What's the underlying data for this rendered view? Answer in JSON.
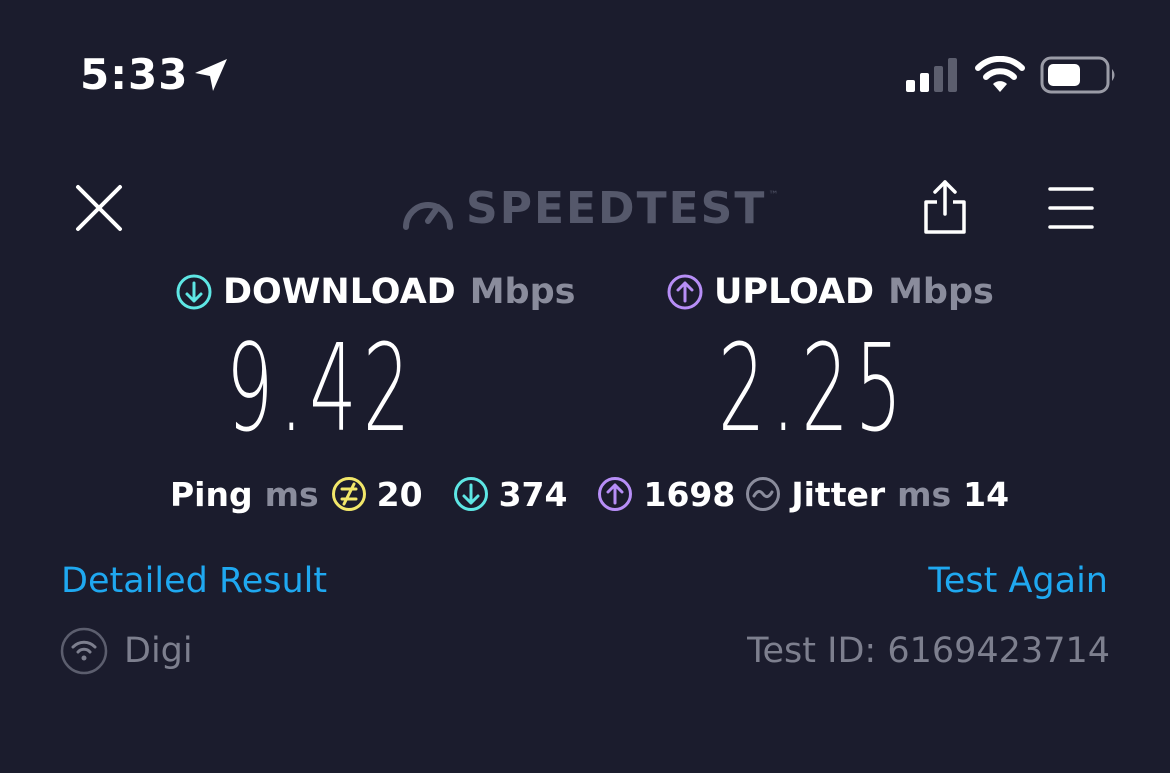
{
  "status_bar": {
    "time": "5:33",
    "icons": [
      "location-arrow-icon",
      "cellular-signal-icon",
      "wifi-icon",
      "battery-icon"
    ]
  },
  "header": {
    "logo_text": "SPEEDTEST",
    "logo_mark": "™",
    "icons": [
      "close-icon",
      "speedometer-icon",
      "share-icon",
      "menu-icon"
    ]
  },
  "download": {
    "label": "DOWNLOAD",
    "unit": "Mbps",
    "value": "9.42",
    "color": "#5ee6e4"
  },
  "upload": {
    "label": "UPLOAD",
    "unit": "Mbps",
    "value": "2.25",
    "color": "#b78ef7"
  },
  "stats": {
    "ping_label": "Ping",
    "ping_unit": "ms",
    "ping_idle": "20",
    "ping_download": "374",
    "ping_upload": "1698",
    "jitter_label": "Jitter",
    "jitter_unit": "ms",
    "jitter_value": "14",
    "ping_color": "#f2e76a"
  },
  "links": {
    "detailed": "Detailed Result",
    "again": "Test Again"
  },
  "footer": {
    "provider": "Digi",
    "test_id": "Test ID: 6169423714"
  },
  "colors": {
    "background": "#1b1c2d",
    "link": "#1fa8f0",
    "muted": "#8a8c9c"
  }
}
